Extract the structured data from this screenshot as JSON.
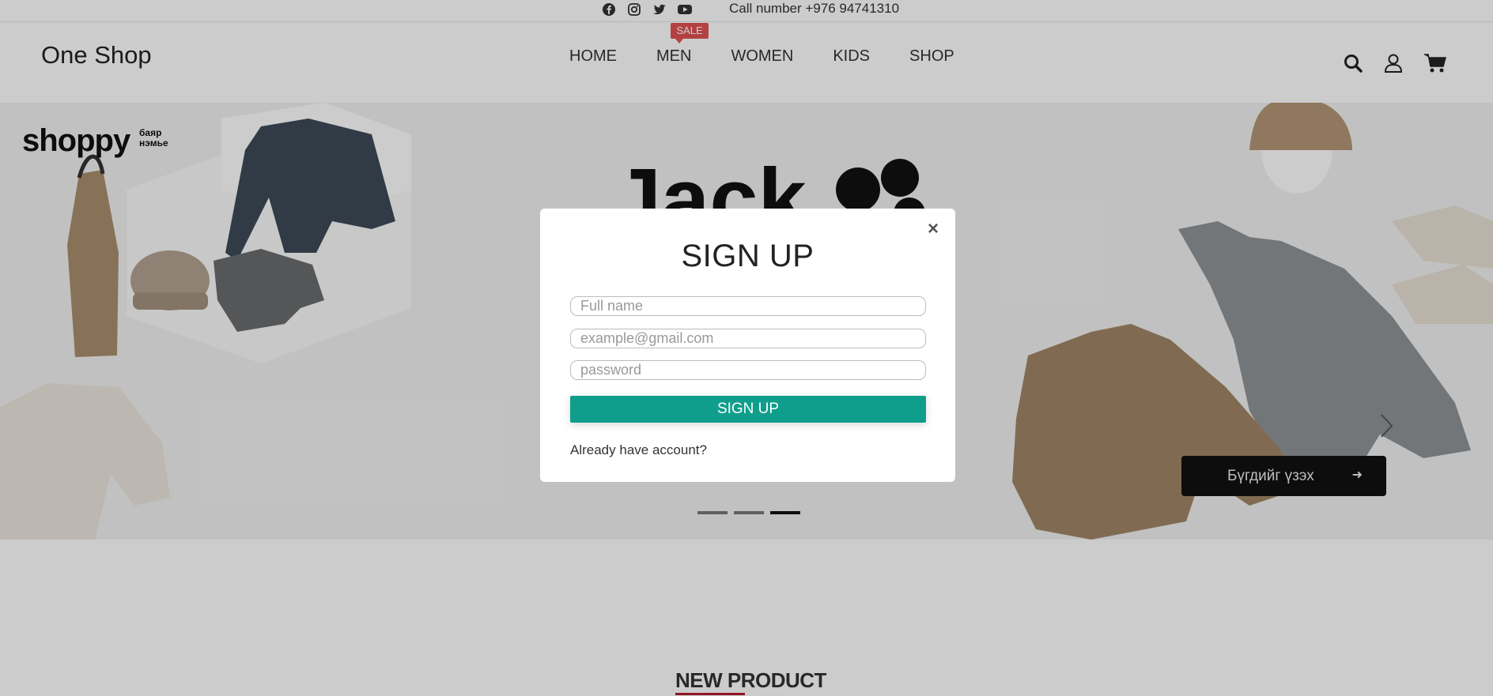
{
  "topbar": {
    "call": "Call number +976 94741310"
  },
  "social": [
    "facebook-icon",
    "instagram-icon",
    "twitter-icon",
    "youtube-icon"
  ],
  "header": {
    "logo": "One Shop",
    "nav": [
      "HOME",
      "MEN",
      "WOMEN",
      "KIDS",
      "SHOP"
    ],
    "sale_badge": "SALE",
    "icons": [
      "search-icon",
      "user-icon",
      "cart-icon"
    ]
  },
  "hero": {
    "brand_word": "shoppy",
    "brand_sub": "баяр\nнэмье",
    "cta_label": "Бүгдийг үзэх",
    "cta_arrow": "➜",
    "active_slide": 3,
    "slide_count": 3
  },
  "modal": {
    "title": "SIGN UP",
    "close": "×",
    "fullname_placeholder": "Full name",
    "email_placeholder": "example@gmail.com",
    "password_placeholder": "password",
    "submit": "SIGN UP",
    "already": "Already have account?"
  },
  "section": {
    "title": "NEW PRODUCT"
  },
  "colors": {
    "accent": "#0f9e8c",
    "sale": "#e05252",
    "underline": "#b31d2f"
  }
}
